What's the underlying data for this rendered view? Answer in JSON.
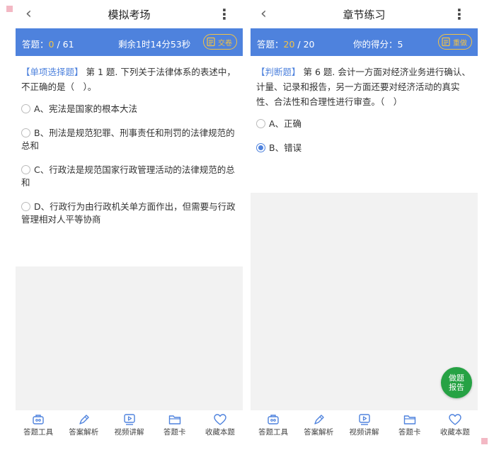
{
  "left": {
    "title": "模拟考场",
    "count_label": "答题：",
    "count_current": "0",
    "count_total": "/ 61",
    "timer": "剩余1时14分53秒",
    "action_label": "交卷",
    "question_tag": "【单项选择题】",
    "question_text": " 第 1 题. 下列关于法律体系的表述中，不正确的是（　）。",
    "options": [
      {
        "text": "A、宪法是国家的根本大法",
        "selected": false
      },
      {
        "text": "B、刑法是规范犯罪、刑事责任和刑罚的法律规范的总和",
        "selected": false
      },
      {
        "text": "C、行政法是规范国家行政管理活动的法律规范的总和",
        "selected": false
      },
      {
        "text": "D、行政行为由行政机关单方面作出，但需要与行政管理相对人平等协商",
        "selected": false
      }
    ]
  },
  "right": {
    "title": "章节练习",
    "count_label": "答题：",
    "count_current": "20",
    "count_total": "/ 20",
    "score": "你的得分：5",
    "action_label": "重做",
    "question_tag": "【判断题】",
    "question_text": " 第 6 题. 会计一方面对经济业务进行确认、计量、记录和报告，另一方面还要对经济活动的真实性、合法性和合理性进行审查。（　）",
    "options": [
      {
        "text": "A、正确",
        "selected": false
      },
      {
        "text": "B、错误",
        "selected": true
      }
    ],
    "report_line1": "做题",
    "report_line2": "报告"
  },
  "tabs": [
    {
      "label": "答题工具",
      "icon": "toolbox-icon"
    },
    {
      "label": "答案解析",
      "icon": "pen-icon"
    },
    {
      "label": "视频讲解",
      "icon": "video-play-icon"
    },
    {
      "label": "答题卡",
      "icon": "folder-icon"
    },
    {
      "label": "收藏本题",
      "icon": "heart-icon"
    }
  ],
  "colors": {
    "primary": "#4e82dd",
    "highlight": "#f5c342",
    "report": "#26a244"
  }
}
